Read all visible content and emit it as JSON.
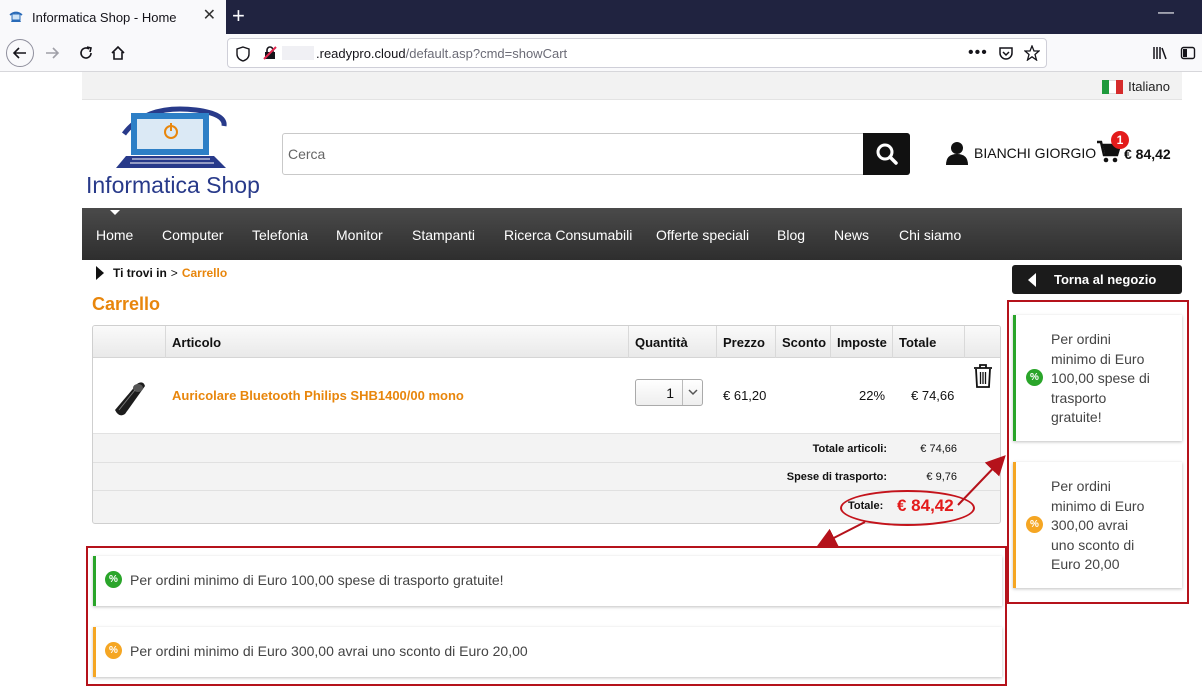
{
  "browser": {
    "tab_title": "Informatica Shop - Home",
    "new_tab": "+",
    "url_domain": ".readypro.cloud",
    "url_path": "/default.asp?cmd=showCart"
  },
  "site": {
    "language": "Italiano",
    "logo_text": "Informatica Shop",
    "search_placeholder": "Cerca",
    "user_name": "BIANCHI GIORGIO",
    "cart_count": "1",
    "cart_total": "€ 84,42"
  },
  "menu": [
    "Home",
    "Computer",
    "Telefonia",
    "Monitor",
    "Stampanti",
    "Ricerca Consumabili",
    "Offerte speciali",
    "Blog",
    "News",
    "Chi siamo"
  ],
  "breadcrumb": {
    "label": "Ti trovi in",
    "sep": ">",
    "current": "Carrello"
  },
  "back_button": "Torna al negozio",
  "page_title": "Carrello",
  "cart": {
    "headers": {
      "article": "Articolo",
      "quantity": "Quantità",
      "price": "Prezzo",
      "discount": "Sconto",
      "tax": "Imposte",
      "total": "Totale"
    },
    "item": {
      "name": "Auricolare Bluetooth Philips SHB1400/00 mono",
      "quantity": "1",
      "price": "€ 61,20",
      "discount": "",
      "tax": "22%",
      "total": "€ 74,66"
    },
    "summary": {
      "articles_label": "Totale articoli:",
      "articles_value": "€ 74,66",
      "shipping_label": "Spese di trasporto:",
      "shipping_value": "€ 9,76",
      "grand_label": "Totale:",
      "grand_value": "€ 84,42"
    }
  },
  "promos": {
    "shipping": "Per ordini minimo di Euro 100,00 spese di trasporto gratuite!",
    "discount": "Per ordini minimo di Euro 300,00 avrai uno sconto di Euro 20,00",
    "icon_symbol": "%",
    "green": "#2aa52a",
    "orange": "#f5a623"
  },
  "colors": {
    "accent": "#e8860c",
    "highlight": "#b5121b",
    "price_red": "#e31b1b"
  }
}
